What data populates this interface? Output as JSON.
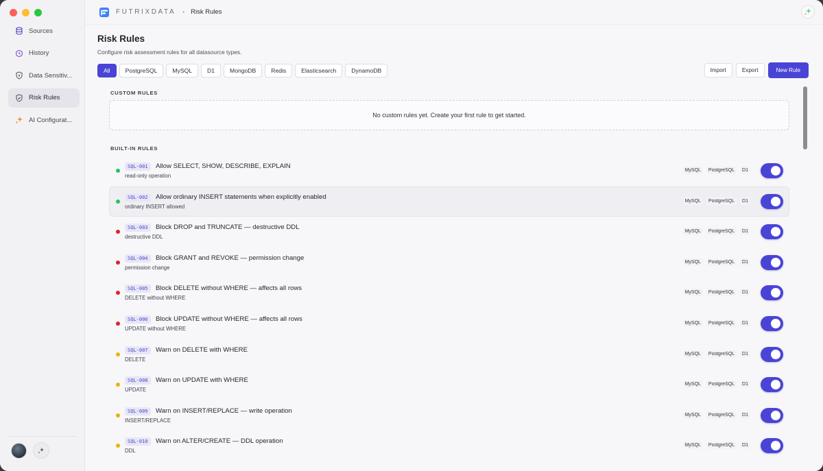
{
  "sidebar": {
    "items": [
      {
        "label": "Sources",
        "icon": "database-icon",
        "active": false
      },
      {
        "label": "History",
        "icon": "history-icon",
        "active": false
      },
      {
        "label": "Data Sensitiv...",
        "icon": "shield-lock-icon",
        "active": false
      },
      {
        "label": "Risk Rules",
        "icon": "shield-check-icon",
        "active": true
      },
      {
        "label": "AI Configurat...",
        "icon": "sparkles-icon",
        "active": false
      }
    ]
  },
  "header": {
    "brand": "FUTRIXDATA",
    "breadcrumb": "Risk Rules"
  },
  "page": {
    "title": "Risk Rules",
    "subtitle": "Configure risk assessment rules for all datasource types."
  },
  "filters": [
    "All",
    "PostgreSQL",
    "MySQL",
    "D1",
    "MongoDB",
    "Redis",
    "Elasticsearch",
    "DynamoDB"
  ],
  "actions": {
    "import": "Import",
    "export": "Export",
    "new_rule": "New Rule"
  },
  "custom_rules": {
    "label": "CUSTOM RULES",
    "empty": "No custom rules yet. Create your first rule to get started."
  },
  "builtin": {
    "label": "BUILT-IN RULES",
    "rules": [
      {
        "id": "SQL-001",
        "title": "Allow SELECT, SHOW, DESCRIBE, EXPLAIN",
        "desc": "read-only operation",
        "level": "allow",
        "tags": [
          "MySQL",
          "PostgreSQL",
          "D1"
        ],
        "enabled": true
      },
      {
        "id": "SQL-002",
        "title": "Allow ordinary INSERT statements when explicitly enabled",
        "desc": "ordinary INSERT allowed",
        "level": "allow",
        "tags": [
          "MySQL",
          "PostgreSQL",
          "D1"
        ],
        "enabled": true
      },
      {
        "id": "SQL-003",
        "title": "Block DROP and TRUNCATE — destructive DDL",
        "desc": "destructive DDL",
        "level": "block",
        "tags": [
          "MySQL",
          "PostgreSQL",
          "D1"
        ],
        "enabled": true
      },
      {
        "id": "SQL-004",
        "title": "Block GRANT and REVOKE — permission change",
        "desc": "permission change",
        "level": "block",
        "tags": [
          "MySQL",
          "PostgreSQL",
          "D1"
        ],
        "enabled": true
      },
      {
        "id": "SQL-005",
        "title": "Block DELETE without WHERE — affects all rows",
        "desc": "DELETE without WHERE",
        "level": "block",
        "tags": [
          "MySQL",
          "PostgreSQL",
          "D1"
        ],
        "enabled": true
      },
      {
        "id": "SQL-006",
        "title": "Block UPDATE without WHERE — affects all rows",
        "desc": "UPDATE without WHERE",
        "level": "block",
        "tags": [
          "MySQL",
          "PostgreSQL",
          "D1"
        ],
        "enabled": true
      },
      {
        "id": "SQL-007",
        "title": "Warn on DELETE with WHERE",
        "desc": "DELETE",
        "level": "warn",
        "tags": [
          "MySQL",
          "PostgreSQL",
          "D1"
        ],
        "enabled": true
      },
      {
        "id": "SQL-008",
        "title": "Warn on UPDATE with WHERE",
        "desc": "UPDATE",
        "level": "warn",
        "tags": [
          "MySQL",
          "PostgreSQL",
          "D1"
        ],
        "enabled": true
      },
      {
        "id": "SQL-009",
        "title": "Warn on INSERT/REPLACE — write operation",
        "desc": "INSERT/REPLACE",
        "level": "warn",
        "tags": [
          "MySQL",
          "PostgreSQL",
          "D1"
        ],
        "enabled": true
      },
      {
        "id": "SQL-010",
        "title": "Warn on ALTER/CREATE — DDL operation",
        "desc": "DDL",
        "level": "warn",
        "tags": [
          "MySQL",
          "PostgreSQL",
          "D1"
        ],
        "enabled": true
      }
    ]
  },
  "colors": {
    "accent": "#4a44d6",
    "allow": "#22c55e",
    "block": "#dc2626",
    "warn": "#eab308"
  }
}
